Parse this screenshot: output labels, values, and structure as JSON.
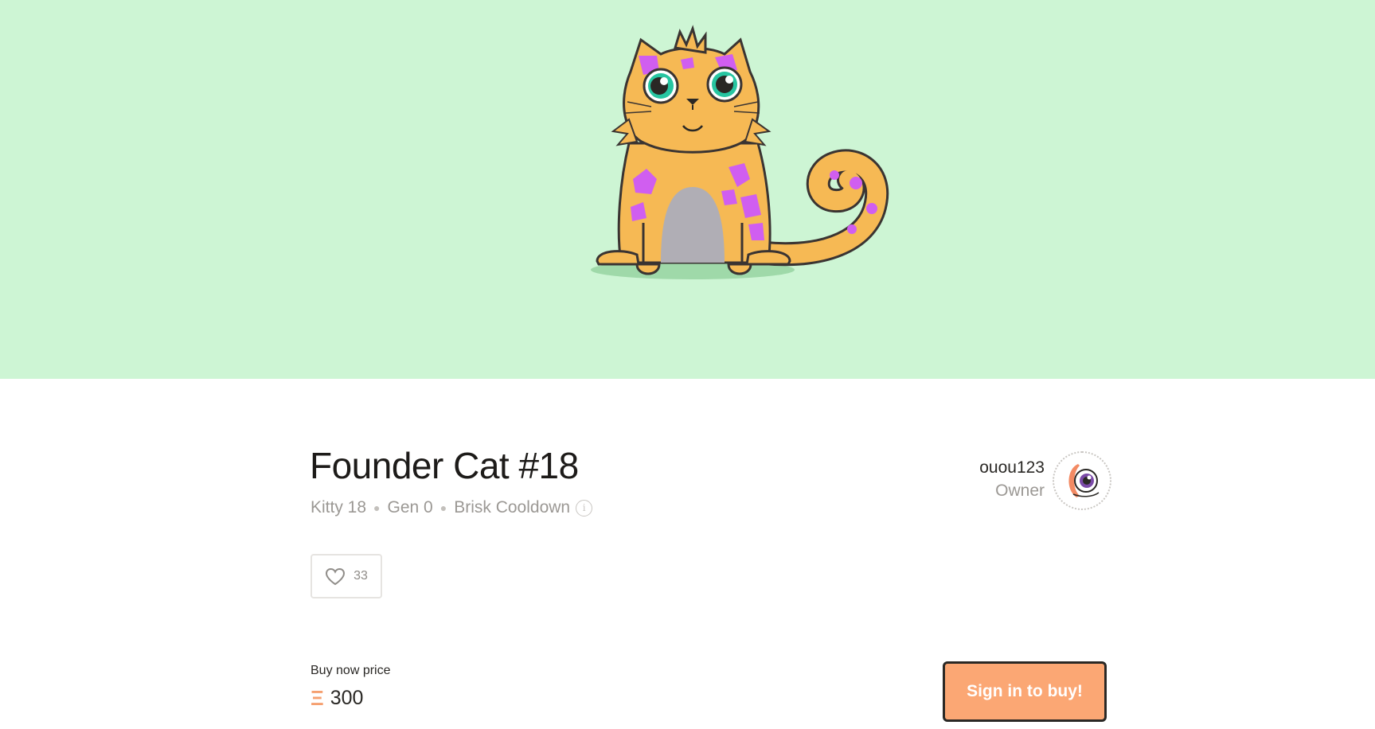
{
  "kitty": {
    "name": "Founder Cat #18",
    "id_label": "Kitty 18",
    "generation": "Gen 0",
    "cooldown": "Brisk Cooldown",
    "info_glyph": "i"
  },
  "likes": {
    "count": "33",
    "icon": "heart-icon"
  },
  "owner": {
    "name": "ouou123",
    "role": "Owner",
    "avatar_icon": "eye-avatar-icon"
  },
  "sale": {
    "price_label": "Buy now price",
    "currency_symbol": "Ξ",
    "price": "300",
    "cta_label": "Sign in to buy!"
  },
  "colors": {
    "hero_background": "#cdf5d4",
    "accent_orange": "#fba774",
    "cat_body": "#f6b954",
    "cat_spots": "#d05ef0",
    "cat_eye": "#27c5a1"
  }
}
